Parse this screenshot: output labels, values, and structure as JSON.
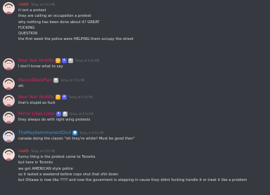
{
  "messages": [
    {
      "username": "rawb",
      "username_color": "#e74c3c",
      "timestamp": "Today at 9:53 PM",
      "avatar": {
        "icon": "anime-avatar-icon",
        "color": "#f4e1e0"
      },
      "badges": [],
      "lines": [
        "it isnt a protest",
        "they are calling an occupation a protest",
        "why nothing has been done about it? GREAT",
        "FUCKING",
        "QUESTION",
        "the first week the police were HELPING them occupy the street"
      ]
    },
    {
      "username": "New Year Noddle",
      "username_color": "#e91e63",
      "timestamp": "Today at 9:54 PM",
      "avatar": {
        "icon": "anime-avatar-icon",
        "color": "#e8ccd0"
      },
      "badges": [
        "emoji-badge",
        "sparkle-badge",
        "cat-badge"
      ],
      "lines": [
        "I don't know what to say"
      ]
    },
    {
      "username": "MauraTakesPlan",
      "username_color": "#e91e63",
      "timestamp": "Today at 9:54 PM",
      "avatar": {
        "icon": "anime-avatar-icon",
        "color": "#f0d4d2"
      },
      "badges": [
        "cat-badge"
      ],
      "lines": [
        "ofc"
      ]
    },
    {
      "username": "New Year Noddle",
      "username_color": "#e91e63",
      "timestamp": "Today at 9:54 PM",
      "avatar": {
        "icon": "anime-avatar-icon",
        "color": "#e8ccd0"
      },
      "badges": [
        "emoji-badge",
        "sparkle-badge"
      ],
      "lines": [
        "that's stupid as fuck"
      ]
    },
    {
      "username": "Mirror Likes Lilies",
      "username_color": "#e91e63",
      "timestamp": "Today at 9:54 PM",
      "avatar": {
        "icon": "anime-avatar-icon",
        "color": "#e6d0d8"
      },
      "badges": [
        "sparkle-badge",
        "cat-badge"
      ],
      "lines": [
        "they always do with right wing protests"
      ]
    },
    {
      "username": "TheMaybeImmanentDivil",
      "username_color": "#3498db",
      "timestamp": "Today at 9:54 PM",
      "avatar": {
        "icon": "anime-avatar-icon",
        "color": "#d6dcf0"
      },
      "badges": [
        "blue-badge"
      ],
      "lines": [
        "canada doing the classic \"oh they're white? Must be good then\""
      ]
    },
    {
      "username": "rawb",
      "username_color": "#e74c3c",
      "timestamp": "Today at 9:55 PM",
      "avatar": {
        "icon": "anime-avatar-icon",
        "color": "#f4e1e0"
      },
      "badges": [],
      "lines": [
        "funny thing is the protest came to Toronto",
        "but here in Toronto",
        "we got AMERICAN style police",
        "so it lasted a weekend before cops shut that shit down",
        "but Ottawa is now like ???? and now the goverment is stepping in cause they didnt fucking handle it or treat it like a problem"
      ]
    }
  ]
}
